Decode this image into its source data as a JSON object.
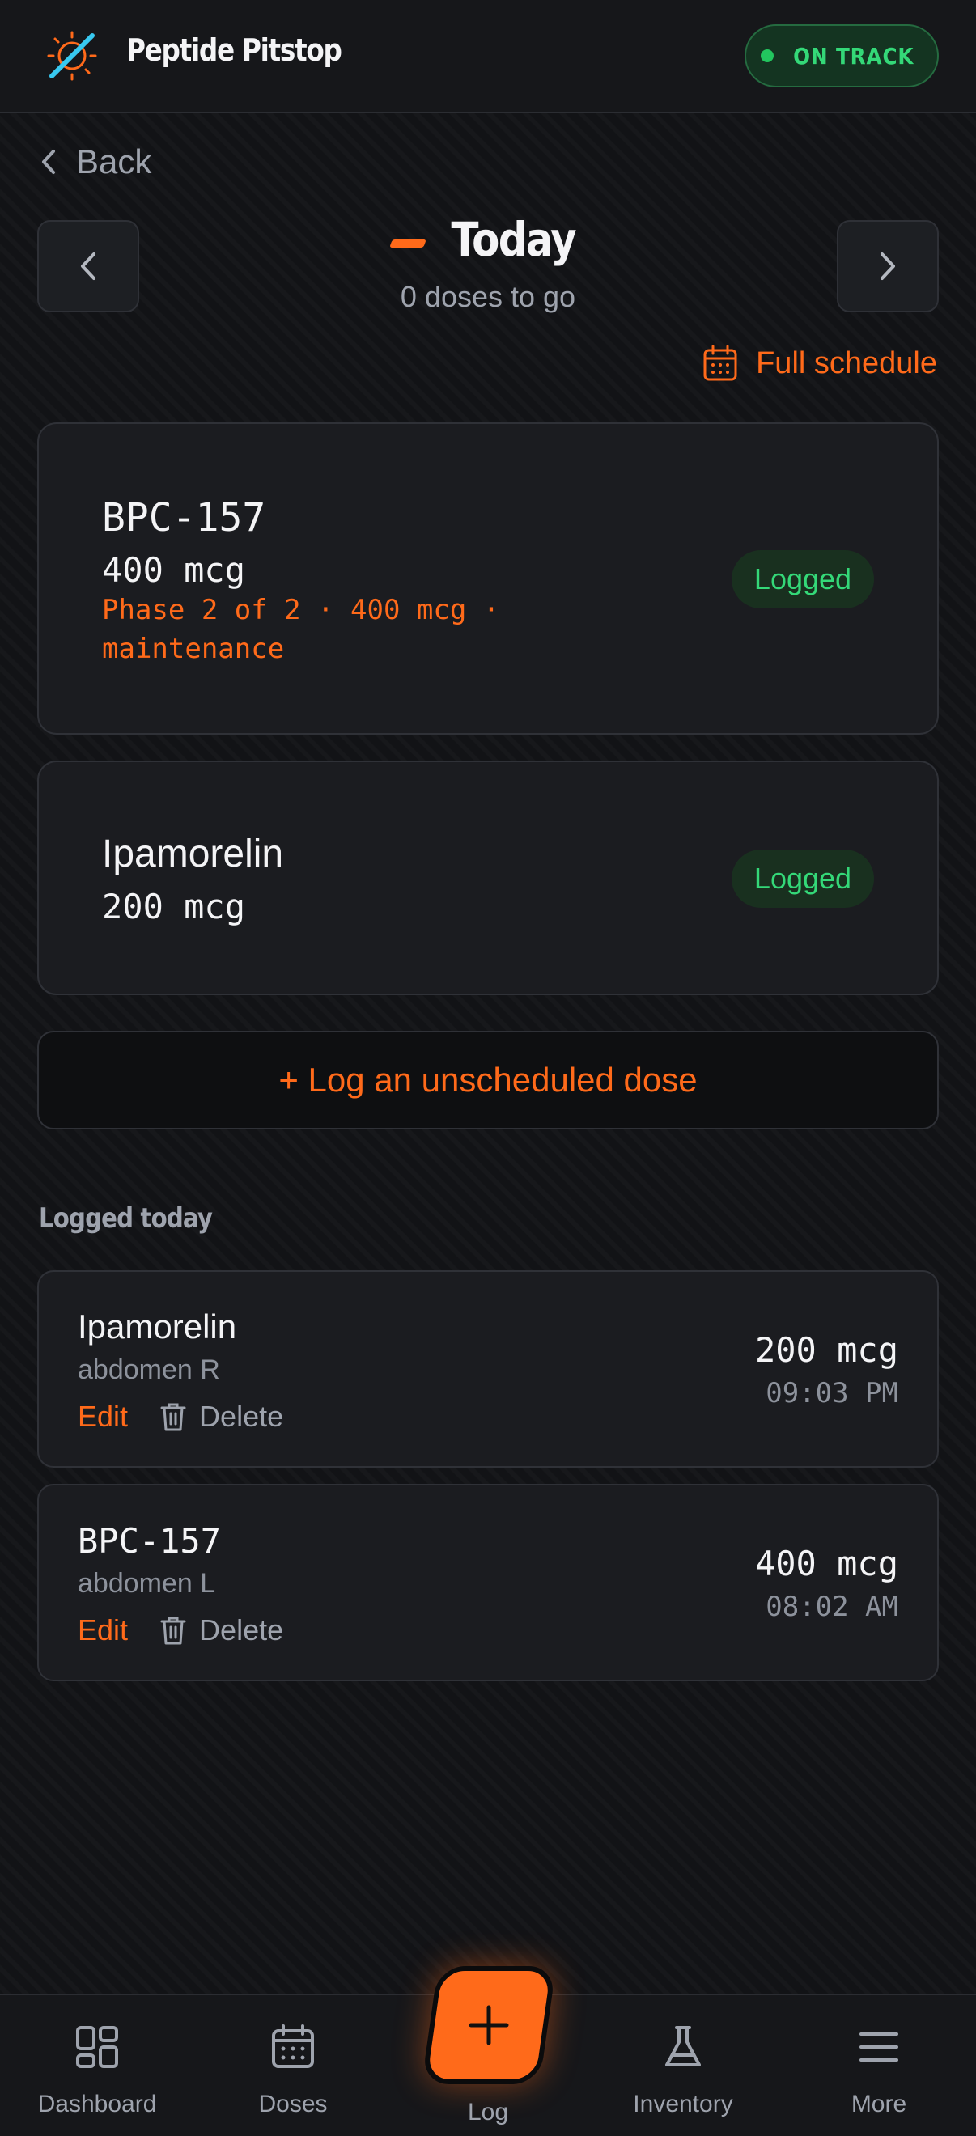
{
  "header": {
    "app_title": "Peptide Pitstop",
    "status": "ON TRACK",
    "logo_icon": "slashed-circle-logo-icon"
  },
  "nav": {
    "back_label": "Back",
    "prev_icon": "chevron-left-icon",
    "next_icon": "chevron-right-icon"
  },
  "day": {
    "title": "Today",
    "subtitle": "0 doses to go",
    "full_schedule_label": "Full schedule"
  },
  "scheduled": [
    {
      "name": "BPC-157",
      "dose": "400 mcg",
      "phase": "Phase 2 of 2 · 400 mcg · maintenance",
      "status": "Logged"
    },
    {
      "name": "Ipamorelin",
      "dose": "200 mcg",
      "status": "Logged"
    }
  ],
  "unscheduled_label": "+ Log an unscheduled dose",
  "logged_today": {
    "title": "Logged today",
    "entries": [
      {
        "name": "Ipamorelin",
        "site": "abdomen R",
        "dose": "200 mcg",
        "time": "09:03 PM",
        "edit_label": "Edit",
        "delete_label": "Delete"
      },
      {
        "name": "BPC-157",
        "site": "abdomen L",
        "dose": "400 mcg",
        "time": "08:02 AM",
        "edit_label": "Edit",
        "delete_label": "Delete"
      }
    ]
  },
  "bottom_nav": {
    "dashboard": "Dashboard",
    "doses": "Doses",
    "log": "Log",
    "inventory": "Inventory",
    "more": "More"
  },
  "colors": {
    "accent": "#ff6a1a",
    "success": "#34d878",
    "background": "#121316",
    "card": "#1b1c20"
  }
}
